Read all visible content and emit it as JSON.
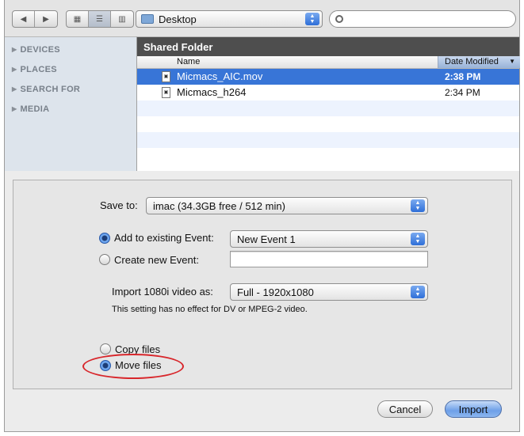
{
  "toolbar": {
    "location_popup": "Desktop",
    "search_placeholder": ""
  },
  "sidebar": {
    "items": [
      {
        "label": "DEVICES"
      },
      {
        "label": "PLACES"
      },
      {
        "label": "SEARCH FOR"
      },
      {
        "label": "MEDIA"
      }
    ]
  },
  "file_browser": {
    "folder_title": "Shared Folder",
    "columns": {
      "name": "Name",
      "date_modified": "Date Modified"
    },
    "files": [
      {
        "name": "Micmacs_AIC.mov",
        "date": "2:38 PM",
        "selected": true
      },
      {
        "name": "Micmacs_h264",
        "date": "2:34 PM",
        "selected": false
      }
    ]
  },
  "import_options": {
    "save_to_label": "Save to:",
    "save_to_value": "imac (34.3GB free / 512 min)",
    "add_event_label": "Add to existing Event:",
    "add_event_value": "New Event 1",
    "create_event_label": "Create new Event:",
    "create_event_value": "",
    "import_1080i_label": "Import 1080i video as:",
    "import_1080i_value": "Full - 1920x1080",
    "import_1080i_note": "This setting has no effect for DV or MPEG-2 video.",
    "copy_files_label": "Copy files",
    "move_files_label": "Move files",
    "selected_event_option": "add",
    "selected_file_option": "move"
  },
  "buttons": {
    "cancel": "Cancel",
    "import": "Import"
  },
  "colors": {
    "accent": "#3875d7",
    "highlight_circle": "#d8262b",
    "folder_header": "#4e4e4e"
  }
}
